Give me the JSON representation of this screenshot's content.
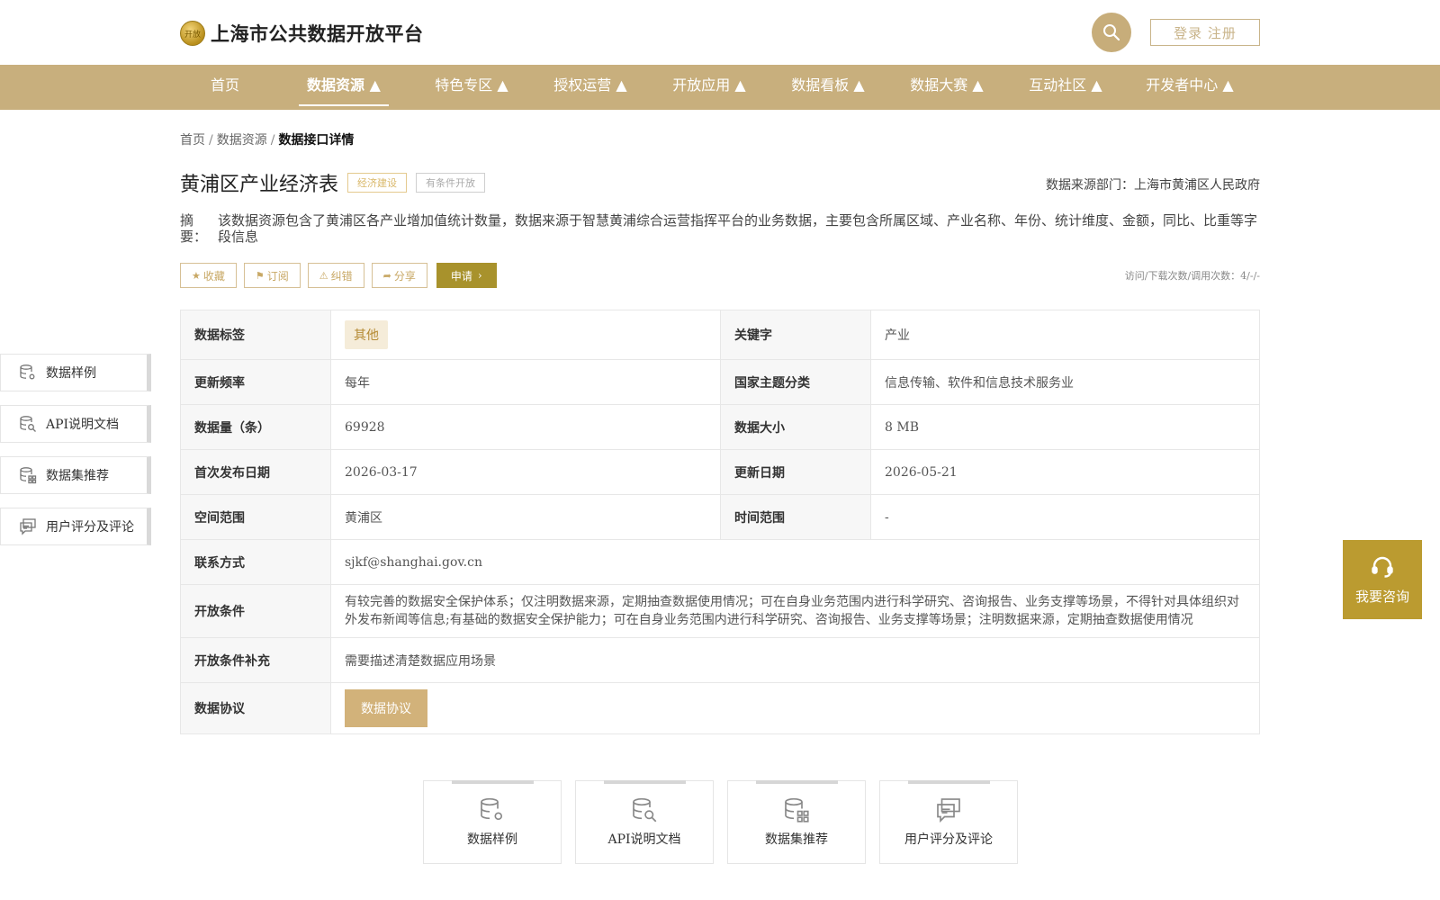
{
  "header": {
    "logo_mark": "开放",
    "site_title": "上海市公共数据开放平台",
    "login_label": "登录 注册"
  },
  "nav": {
    "items": [
      {
        "label": "首页"
      },
      {
        "label": "数据资源 ▲"
      },
      {
        "label": "特色专区 ▲"
      },
      {
        "label": "授权运营 ▲"
      },
      {
        "label": "开放应用 ▲"
      },
      {
        "label": "数据看板 ▲"
      },
      {
        "label": "数据大赛 ▲"
      },
      {
        "label": "互动社区 ▲"
      },
      {
        "label": "开发者中心 ▲"
      }
    ],
    "active_index": 1
  },
  "breadcrumb": {
    "home": "首页",
    "sep": "/",
    "section": "数据资源",
    "current": "数据接口详情"
  },
  "dataset": {
    "title": "黄浦区产业经济表",
    "tag_category": "经济建设",
    "tag_access": "有条件开放",
    "source": "数据来源部门：上海市黄浦区人民政府",
    "abstract_label": "摘　要：",
    "abstract": "该数据资源包含了黄浦区各产业增加值统计数量，数据来源于智慧黄浦综合运营指挥平台的业务数据，主要包含所属区域、产业名称、年份、统计维度、金额，同比、比重等字段信息"
  },
  "actions": {
    "favorite": "收藏",
    "subscribe": "订阅",
    "report": "纠错",
    "share": "分享",
    "apply": "申请",
    "stats": "访问/下载次数/调用次数：4/-/-"
  },
  "sidenav": {
    "items": [
      {
        "label": "数据样例"
      },
      {
        "label": "API说明文档"
      },
      {
        "label": "数据集推荐"
      },
      {
        "label": "用户评分及评论"
      }
    ]
  },
  "table": {
    "tag_label": "数据标签",
    "tag_value": "其他",
    "keyword_label": "关键字",
    "keyword_value": "产业",
    "freq_label": "更新频率",
    "freq_value": "每年",
    "theme_label": "国家主题分类",
    "theme_value": "信息传输、软件和信息技术服务业",
    "count_label": "数据量（条）",
    "count_value": "69928",
    "size_label": "数据大小",
    "size_value": "8 MB",
    "first_label": "首次发布日期",
    "first_value": "2026-03-17",
    "update_label": "更新日期",
    "update_value": "2026-05-21",
    "space_label": "空间范围",
    "space_value": "黄浦区",
    "time_label": "时间范围",
    "time_value": "-",
    "contact_label": "联系方式",
    "contact_value": "sjkf@shanghai.gov.cn",
    "cond_label": "开放条件",
    "cond_value": "有较完善的数据安全保护体系；仅注明数据来源，定期抽查数据使用情况；可在自身业务范围内进行科学研究、咨询报告、业务支撑等场景，不得针对具体组织对外发布新闻等信息;有基础的数据安全保护能力；可在自身业务范围内进行科学研究、咨询报告、业务支撑等场景；注明数据来源，定期抽查数据使用情况",
    "cond_extra_label": "开放条件补充",
    "cond_extra_value": "需要描述清楚数据应用场景",
    "agreement_label": "数据协议",
    "agreement_button": "数据协议"
  },
  "consult": {
    "label": "我要咨询"
  },
  "cards": [
    {
      "label": "数据样例",
      "icon": "database-gear-icon"
    },
    {
      "label": "API说明文档",
      "icon": "database-search-icon"
    },
    {
      "label": "数据集推荐",
      "icon": "database-grid-icon"
    },
    {
      "label": "用户评分及评论",
      "icon": "comments-icon"
    }
  ],
  "colors": {
    "brand": "#c8af7d",
    "apply": "#a8922c",
    "consult": "#bb9b30"
  }
}
